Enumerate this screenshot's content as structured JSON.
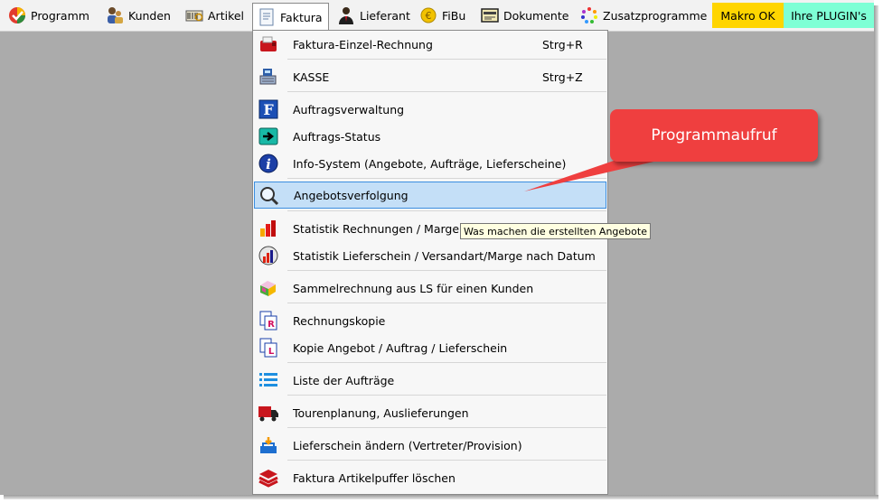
{
  "menubar": {
    "items": [
      {
        "label": "Programm",
        "icon": "program-icon"
      },
      {
        "label": "Kunden",
        "icon": "customers-icon"
      },
      {
        "label": "Artikel",
        "icon": "articles-icon"
      },
      {
        "label": "Faktura",
        "icon": "invoice-icon",
        "active": true
      },
      {
        "label": "Lieferant",
        "icon": "supplier-icon"
      },
      {
        "label": "FiBu",
        "icon": "fibu-icon"
      },
      {
        "label": "Dokumente",
        "icon": "documents-icon"
      },
      {
        "label": "Zusatzprogramme",
        "icon": "addons-icon"
      }
    ],
    "makro_label": "Makro OK",
    "plugin_label": "Ihre PLUGIN's",
    "makro_color": "#ffd500",
    "plugin_color": "#7effd5"
  },
  "faktura_menu": {
    "items": [
      {
        "label": "Faktura-Einzel-Rechnung",
        "shortcut": "Strg+R",
        "icon": "invoice-single-icon"
      },
      {
        "label": "KASSE",
        "shortcut": "Strg+Z",
        "icon": "cash-register-icon"
      },
      {
        "label": "Auftragsverwaltung",
        "icon": "order-management-icon"
      },
      {
        "label": "Auftrags-Status",
        "icon": "order-status-icon"
      },
      {
        "label": "Info-System (Angebote, Aufträge, Lieferscheine)",
        "icon": "info-icon"
      },
      {
        "label": "Angebotsverfolgung",
        "icon": "magnifier-icon",
        "highlighted": true
      },
      {
        "label": "Statistik Rechnungen / Marge nach",
        "icon": "chart-icon"
      },
      {
        "label": "Statistik Lieferschein / Versandart/Marge nach Datum",
        "icon": "chart-delivery-icon"
      },
      {
        "label": "Sammelrechnung aus LS für einen Kunden",
        "icon": "collective-invoice-icon"
      },
      {
        "label": "Rechnungskopie",
        "icon": "invoice-copy-icon"
      },
      {
        "label": "Kopie Angebot / Auftrag / Lieferschein",
        "icon": "document-copy-icon"
      },
      {
        "label": "Liste der Aufträge",
        "icon": "list-icon"
      },
      {
        "label": "Tourenplanung, Auslieferungen",
        "icon": "truck-icon"
      },
      {
        "label": "Lieferschein ändern (Vertreter/Provision)",
        "icon": "edit-delivery-icon"
      },
      {
        "label": "Faktura Artikelpuffer löschen",
        "icon": "layers-icon"
      }
    ]
  },
  "callout": {
    "text": "Programmaufruf",
    "color": "#ef3f3f"
  },
  "tooltip": {
    "text": "Was machen die erstellten Angebote"
  }
}
